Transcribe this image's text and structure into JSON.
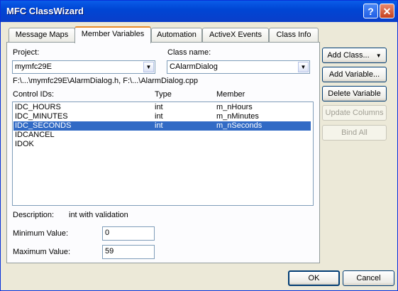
{
  "window": {
    "title": "MFC ClassWizard",
    "help_glyph": "?",
    "close_glyph": "✕"
  },
  "tabs": [
    {
      "label": "Message Maps"
    },
    {
      "label": "Member Variables"
    },
    {
      "label": "Automation"
    },
    {
      "label": "ActiveX Events"
    },
    {
      "label": "Class Info"
    }
  ],
  "active_tab": "Member Variables",
  "project": {
    "label": "Project:",
    "value": "mymfc29E"
  },
  "class_name": {
    "label": "Class name:",
    "value": "CAlarmDialog"
  },
  "path_text": "F:\\...\\mymfc29E\\AlarmDialog.h, F:\\...\\AlarmDialog.cpp",
  "list": {
    "headers": {
      "control": "Control IDs:",
      "type": "Type",
      "member": "Member"
    },
    "rows": [
      {
        "id": "IDC_HOURS",
        "type": "int",
        "member": "m_nHours",
        "selected": false
      },
      {
        "id": "IDC_MINUTES",
        "type": "int",
        "member": "m_nMinutes",
        "selected": false
      },
      {
        "id": "IDC_SECONDS",
        "type": "int",
        "member": "m_nSeconds",
        "selected": true
      },
      {
        "id": "IDCANCEL",
        "type": "",
        "member": "",
        "selected": false
      },
      {
        "id": "IDOK",
        "type": "",
        "member": "",
        "selected": false
      }
    ]
  },
  "description": {
    "label": "Description:",
    "value": "int with validation"
  },
  "min_value": {
    "label": "Minimum Value:",
    "value": "0"
  },
  "max_value": {
    "label": "Maximum Value:",
    "value": "59"
  },
  "side_buttons": {
    "add_class": "Add Class...",
    "add_class_arrow": "▼",
    "add_variable": "Add Variable...",
    "delete_variable": "Delete Variable",
    "update_columns": "Update Columns",
    "bind_all": "Bind All"
  },
  "footer": {
    "ok": "OK",
    "cancel": "Cancel"
  },
  "colors": {
    "titlebar": "#0a5de9",
    "selection": "#316ac5",
    "tab_accent": "#e68b2c"
  }
}
